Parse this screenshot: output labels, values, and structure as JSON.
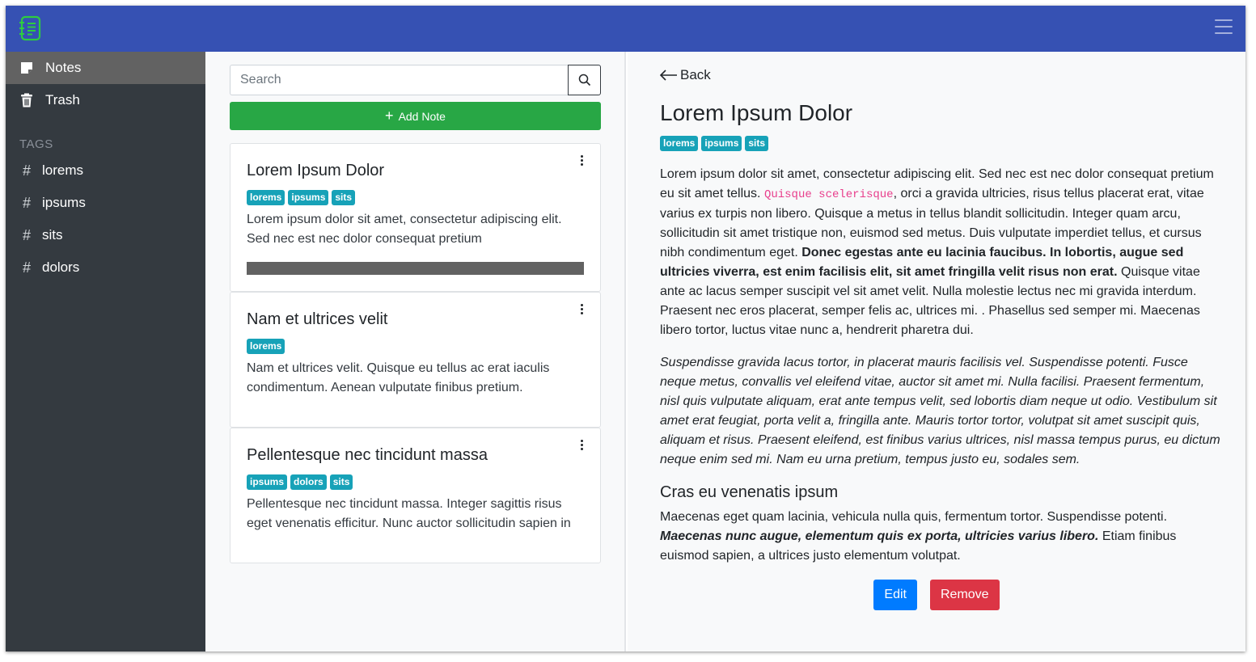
{
  "colors": {
    "topbar": "#3651b3",
    "sidebar": "#343a40",
    "active_item": "#626262",
    "badge": "#17a2b8",
    "add_button": "#28a745",
    "edit_button": "#007bff",
    "remove_button": "#dc3545",
    "logo": "#2ecc40"
  },
  "sidebar": {
    "nav": [
      {
        "label": "Notes",
        "icon": "note-icon",
        "active": true
      },
      {
        "label": "Trash",
        "icon": "trash-icon",
        "active": false
      }
    ],
    "tags_title": "TAGS",
    "tags": [
      "lorems",
      "ipsums",
      "sits",
      "dolors"
    ]
  },
  "list": {
    "search_placeholder": "Search",
    "add_label": "Add Note",
    "notes": [
      {
        "title": "Lorem Ipsum Dolor",
        "tags": [
          "lorems",
          "ipsums",
          "sits"
        ],
        "excerpt": "Lorem ipsum dolor sit amet, consectetur adipiscing elit. Sed nec est nec dolor consequat pretium"
      },
      {
        "title": "Nam et ultrices velit",
        "tags": [
          "lorems"
        ],
        "excerpt": "Nam et ultrices velit. Quisque eu tellus ac erat iaculis condimentum. Aenean vulputate finibus pretium."
      },
      {
        "title": "Pellentesque nec tincidunt massa",
        "tags": [
          "ipsums",
          "dolors",
          "sits"
        ],
        "excerpt": "Pellentesque nec tincidunt massa. Integer sagittis risus eget venenatis efficitur. Nunc auctor sollicitudin sapien in"
      }
    ]
  },
  "detail": {
    "back_label": "Back",
    "title": "Lorem Ipsum Dolor",
    "tags": [
      "lorems",
      "ipsums",
      "sits"
    ],
    "p1_a": "Lorem ipsum dolor sit amet, consectetur adipiscing elit. Sed nec est nec dolor consequat pretium eu sit amet tellus. ",
    "p1_code": "Quisque scelerisque",
    "p1_b": ", orci a gravida ultricies, risus tellus placerat erat, vitae varius ex turpis non libero. Quisque a metus in tellus blandit sollicitudin. Integer quam arcu, sollicitudin sit amet tristique non, euismod sed metus. Duis vulputate imperdiet tellus, et cursus nibh condimentum eget. ",
    "p1_bold": "Donec egestas ante eu lacinia faucibus. In lobortis, augue sed ultricies viverra, est enim facilisis elit, sit amet fringilla velit risus non erat.",
    "p1_c": " Quisque vitae ante ac lacus semper suscipit vel sit amet velit. Nulla molestie lectus nec mi gravida interdum. Praesent nec eros placerat, semper felis ac, ultrices mi. . Phasellus sed semper mi. Maecenas libero tortor, luctus vitae nunc a, hendrerit pharetra dui.",
    "p2_italic": "Suspendisse gravida lacus tortor, in placerat mauris facilisis vel. Suspendisse potenti. Fusce neque metus, convallis vel eleifend vitae, auctor sit amet mi. Nulla facilisi. Praesent fermentum, nisl quis vulputate aliquam, erat ante tempus velit, sed lobortis diam neque ut odio. Vestibulum sit amet erat feugiat, porta velit a, fringilla ante. Mauris tortor tortor, volutpat sit amet suscipit quis, aliquam et risus. Praesent eleifend, est finibus varius ultrices, nisl massa tempus purus, eu dictum neque enim sed mi. Nam eu urna pretium, tempus justo eu, sodales sem.",
    "h3": "Cras eu venenatis ipsum",
    "p3_a": "Maecenas eget quam lacinia, vehicula nulla quis, fermentum tortor. Suspendisse potenti. ",
    "p3_bolditalic": "Maecenas nunc augue, elementum quis ex porta, ultricies varius libero.",
    "p3_b": " Etiam finibus euismod sapien, a ultrices justo elementum volutpat.",
    "edit_label": "Edit",
    "remove_label": "Remove"
  }
}
